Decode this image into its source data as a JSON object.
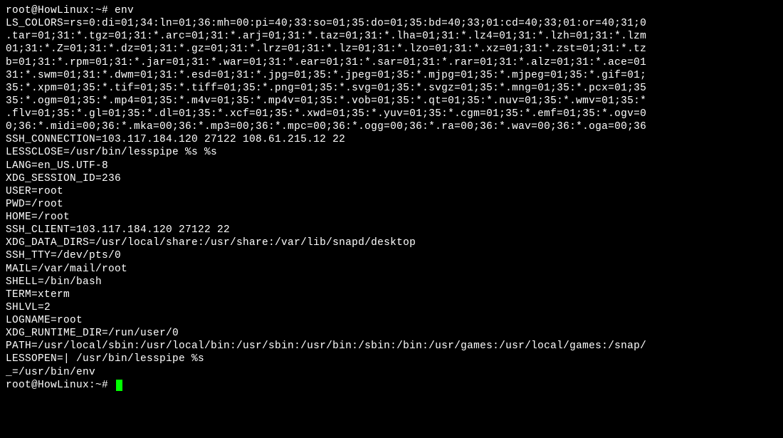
{
  "prompt1": {
    "text": "root@HowLinux:~# ",
    "command": "env"
  },
  "output_lines": [
    "LS_COLORS=rs=0:di=01;34:ln=01;36:mh=00:pi=40;33:so=01;35:do=01;35:bd=40;33;01:cd=40;33;01:or=40;31;0",
    ".tar=01;31:*.tgz=01;31:*.arc=01;31:*.arj=01;31:*.taz=01;31:*.lha=01;31:*.lz4=01;31:*.lzh=01;31:*.lzm",
    "01;31:*.Z=01;31:*.dz=01;31:*.gz=01;31:*.lrz=01;31:*.lz=01;31:*.lzo=01;31:*.xz=01;31:*.zst=01;31:*.tz",
    "b=01;31:*.rpm=01;31:*.jar=01;31:*.war=01;31:*.ear=01;31:*.sar=01;31:*.rar=01;31:*.alz=01;31:*.ace=01",
    "31:*.swm=01;31:*.dwm=01;31:*.esd=01;31:*.jpg=01;35:*.jpeg=01;35:*.mjpg=01;35:*.mjpeg=01;35:*.gif=01;",
    "35:*.xpm=01;35:*.tif=01;35:*.tiff=01;35:*.png=01;35:*.svg=01;35:*.svgz=01;35:*.mng=01;35:*.pcx=01;35",
    "35:*.ogm=01;35:*.mp4=01;35:*.m4v=01;35:*.mp4v=01;35:*.vob=01;35:*.qt=01;35:*.nuv=01;35:*.wmv=01;35:*",
    ".flv=01;35:*.gl=01;35:*.dl=01;35:*.xcf=01;35:*.xwd=01;35:*.yuv=01;35:*.cgm=01;35:*.emf=01;35:*.ogv=0",
    "0;36:*.midi=00;36:*.mka=00;36:*.mp3=00;36:*.mpc=00;36:*.ogg=00;36:*.ra=00;36:*.wav=00;36:*.oga=00;36",
    "SSH_CONNECTION=103.117.184.120 27122 108.61.215.12 22",
    "LESSCLOSE=/usr/bin/lesspipe %s %s",
    "LANG=en_US.UTF-8",
    "XDG_SESSION_ID=236",
    "USER=root",
    "PWD=/root",
    "HOME=/root",
    "SSH_CLIENT=103.117.184.120 27122 22",
    "XDG_DATA_DIRS=/usr/local/share:/usr/share:/var/lib/snapd/desktop",
    "SSH_TTY=/dev/pts/0",
    "MAIL=/var/mail/root",
    "SHELL=/bin/bash",
    "TERM=xterm",
    "SHLVL=2",
    "LOGNAME=root",
    "XDG_RUNTIME_DIR=/run/user/0",
    "PATH=/usr/local/sbin:/usr/local/bin:/usr/sbin:/usr/bin:/sbin:/bin:/usr/games:/usr/local/games:/snap/",
    "LESSOPEN=| /usr/bin/lesspipe %s",
    "_=/usr/bin/env"
  ],
  "prompt2": {
    "text": "root@HowLinux:~# "
  }
}
